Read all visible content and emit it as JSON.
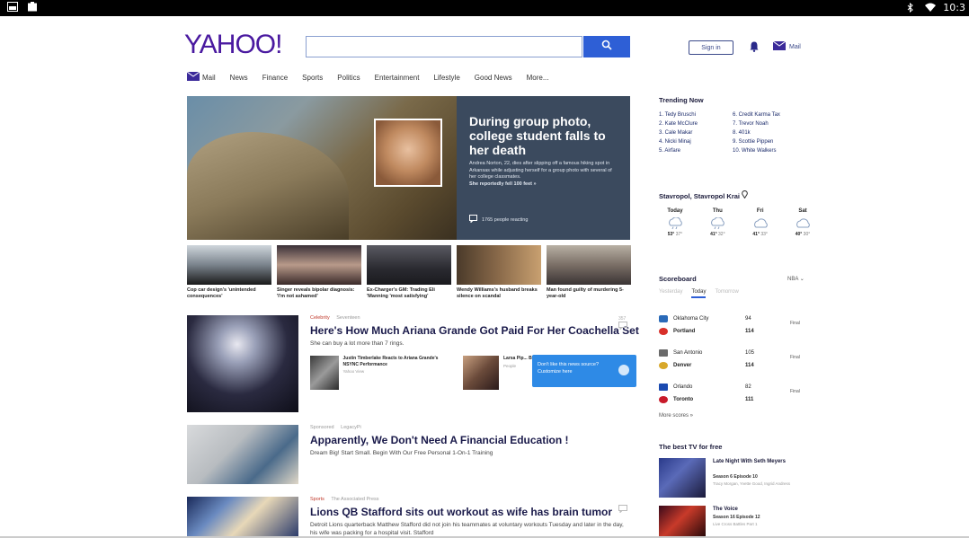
{
  "status_bar": {
    "time": "10:3"
  },
  "header": {
    "logo": "YAHOO!",
    "search_placeholder": "",
    "signin": "Sign in",
    "mail": "Mail"
  },
  "nav": [
    "Mail",
    "News",
    "Finance",
    "Sports",
    "Politics",
    "Entertainment",
    "Lifestyle",
    "Good News",
    "More..."
  ],
  "hero": {
    "title": "During group photo, college student falls to her death",
    "body": "Andrea Norton, 22, dies after slipping off a famous hiking spot in Arkansas while adjusting herself for a group photo with several of her college classmates.",
    "body2": "She reportedly fell 100 feet »",
    "reacting": "1765 people reacting"
  },
  "thumbs": [
    {
      "caption": "Cop car design's 'unintended consequences'"
    },
    {
      "caption": "Singer reveals bipolar diagnosis: 'I'm not ashamed'"
    },
    {
      "caption": "Ex-Charger's GM: Trading Eli 'Manning 'most satisfying'"
    },
    {
      "caption": "Wendy Williams's husband breaks silence on scandal"
    },
    {
      "caption": "Man found guilty of murdering 5-year-old"
    }
  ],
  "stories": [
    {
      "category": "Celebrity",
      "source": "Seventeen",
      "title": "Here's How Much Ariana Grande Got Paid For Her Coachella Set",
      "sub": "She can buy a lot more than 7 rings.",
      "comments": "357",
      "related": [
        {
          "title": "Justin Timberlake Reacts to Ariana Grande's NSYNC Performance",
          "source": "Yahoo View"
        },
        {
          "title": "Larsa Pip... BFF Kim K... Heartbroke...",
          "source": "People"
        }
      ]
    },
    {
      "category": "Sponsored",
      "source": "LegacyPi",
      "title": "Apparently, We Don't Need A Financial Education !",
      "sub": "Dream Big! Start Small. Begin With Our Free Personal 1-On-1 Training"
    },
    {
      "category": "Sports",
      "source": "The Associated Press",
      "title": "Lions QB Stafford sits out workout as wife has brain tumor",
      "sub": "Detroit Lions quarterback Matthew Stafford did not join his teammates at voluntary workouts Tuesday and later in the day, his wife was packing for a hospital visit. Stafford"
    }
  ],
  "tooltip": "Don't like this news source? Customize here",
  "trending": {
    "title": "Trending Now",
    "items": [
      "1. Tedy Bruschi",
      "6. Credit Karma Tax",
      "2. Kate McClure",
      "7. Trevor Noah",
      "3. Cale Makar",
      "8. 401k",
      "4. Nicki Minaj",
      "9. Scottie Pippen",
      "5. Airfare",
      "10. White Walkers"
    ]
  },
  "weather": {
    "location": "Stavropol, Stavropol Krai",
    "days": [
      {
        "day": "Today",
        "hi": "53°",
        "lo": "37°"
      },
      {
        "day": "Thu",
        "hi": "41°",
        "lo": "32°"
      },
      {
        "day": "Fri",
        "hi": "41°",
        "lo": "33°"
      },
      {
        "day": "Sat",
        "hi": "40°",
        "lo": "30°"
      }
    ]
  },
  "scoreboard": {
    "title": "Scoreboard",
    "league": "NBA",
    "tabs": [
      "Yesterday",
      "Today",
      "Tomorrow"
    ],
    "games": [
      {
        "t1": "Oklahoma City",
        "s1": "94",
        "t2": "Portland",
        "s2": "114",
        "status": "Final"
      },
      {
        "t1": "San Antonio",
        "s1": "105",
        "t2": "Denver",
        "s2": "114",
        "status": "Final"
      },
      {
        "t1": "Orlando",
        "s1": "82",
        "t2": "Toronto",
        "s2": "111",
        "status": "Final"
      }
    ],
    "more": "More scores »"
  },
  "tv": {
    "title": "The best TV for free",
    "items": [
      {
        "title": "Late Night With Seth Meyers",
        "episode": "Season 6 Episode 10",
        "cast": "Tracy Morgan, Yvette Good, Ingrid Andress"
      },
      {
        "title": "The Voice",
        "episode": "Season 16 Episode 12",
        "cast": "Live Cross Battles Part 1"
      }
    ]
  }
}
